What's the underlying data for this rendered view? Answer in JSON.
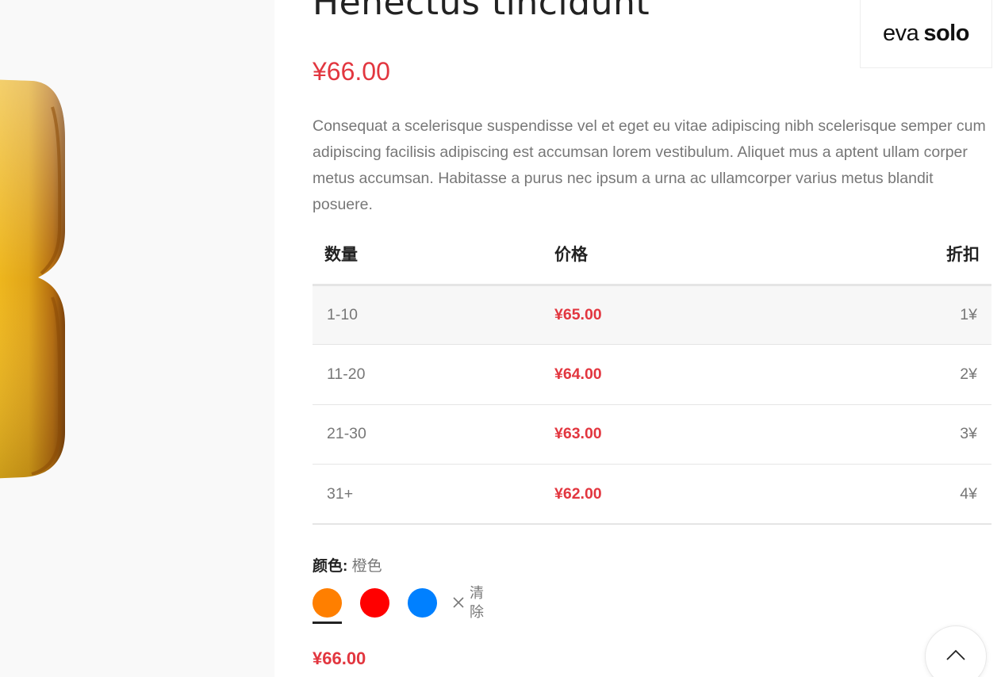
{
  "product": {
    "title": "Henectus tincidunt",
    "price": "¥66.00",
    "description": "Consequat a scelerisque suspendisse vel et eget eu vitae adipiscing nibh scelerisque semper cum adipiscing facilisis adipiscing est accumsan lorem vestibulum. Aliquet mus a aptent ullam corper metus accumsan. Habitasse a purus nec ipsum a urna ac ullamcorper varius metus blandit posuere."
  },
  "brand": {
    "name_light": "eva",
    "name_bold": "solo"
  },
  "pricing_table": {
    "headers": {
      "quantity": "数量",
      "price": "价格",
      "discount": "折扣"
    },
    "rows": [
      {
        "quantity": "1-10",
        "price": "¥65.00",
        "discount": "1¥"
      },
      {
        "quantity": "11-20",
        "price": "¥64.00",
        "discount": "2¥"
      },
      {
        "quantity": "21-30",
        "price": "¥63.00",
        "discount": "3¥"
      },
      {
        "quantity": "31+",
        "price": "¥62.00",
        "discount": "4¥"
      }
    ]
  },
  "color_selector": {
    "label": "颜色",
    "separator": ":",
    "selected": "橙色",
    "swatches": [
      {
        "name": "orange",
        "color": "#ff7f00"
      },
      {
        "name": "red",
        "color": "#ff0000"
      },
      {
        "name": "blue",
        "color": "#0080ff"
      }
    ],
    "clear_label": "清除"
  },
  "selected_price": "¥66.00",
  "icons": {
    "clear": "close-icon",
    "back_to_top": "chevron-up-icon"
  },
  "colors": {
    "price_accent": "#e2363f",
    "heading": "#222222",
    "body_text": "#777777"
  }
}
